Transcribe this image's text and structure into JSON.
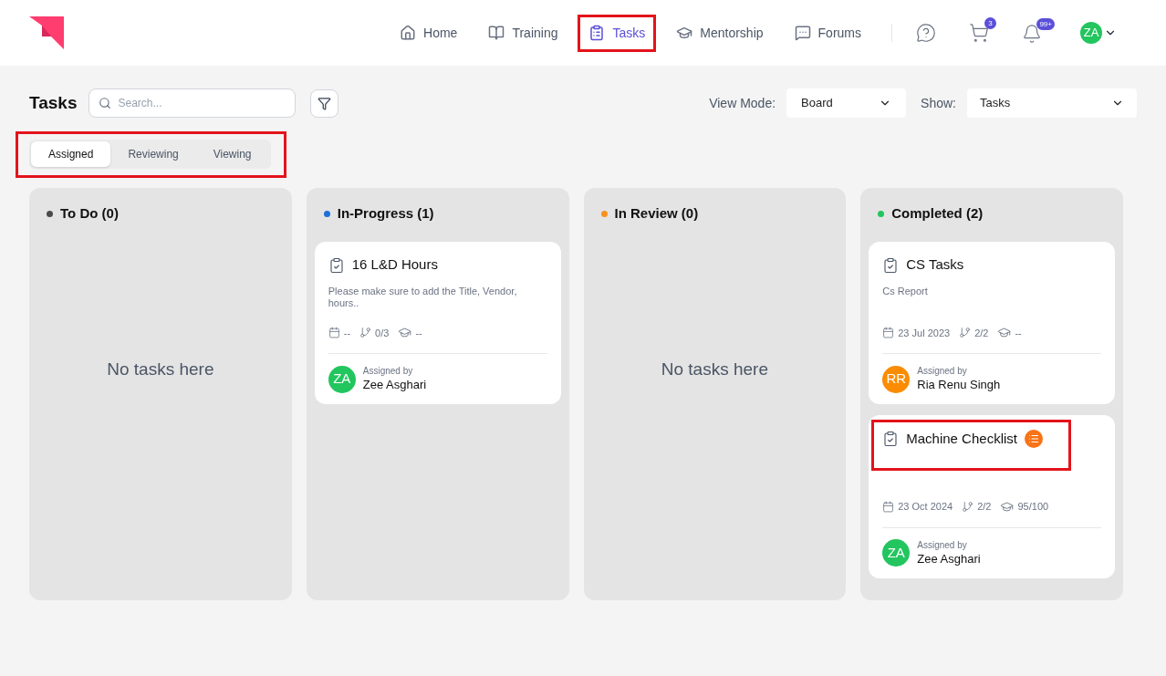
{
  "nav": {
    "items": [
      {
        "label": "Home",
        "selected": false,
        "highlighted": false
      },
      {
        "label": "Training",
        "selected": false,
        "highlighted": false
      },
      {
        "label": "Tasks",
        "selected": true,
        "highlighted": true
      },
      {
        "label": "Mentorship",
        "selected": false,
        "highlighted": false
      },
      {
        "label": "Forums",
        "selected": false,
        "highlighted": false
      }
    ],
    "cart_badge": "3",
    "bell_badge": "99+",
    "avatar": {
      "initials": "ZA",
      "color": "#22c55e"
    }
  },
  "toolbar": {
    "title": "Tasks",
    "search": {
      "placeholder": "Search..."
    },
    "view_mode": {
      "label": "View Mode:",
      "value": "Board"
    },
    "show": {
      "label": "Show:",
      "value": "Tasks"
    }
  },
  "tabs": {
    "highlighted": true,
    "items": [
      {
        "label": "Assigned",
        "selected": true
      },
      {
        "label": "Reviewing",
        "selected": false
      },
      {
        "label": "Viewing",
        "selected": false
      }
    ]
  },
  "columns": [
    {
      "title": "To Do (0)",
      "color": "#4b4b4b",
      "empty_text": "No tasks here"
    },
    {
      "title": "In-Progress (1)",
      "color": "#1e6fd9",
      "cards": [
        {
          "title": "16 L&D Hours",
          "checklist": false,
          "highlighted": false,
          "description": "Please make sure to add the Title, Vendor, hours..",
          "date": "--",
          "subtasks": "0/3",
          "score": "--",
          "assigned_label": "Assigned by",
          "assignee": "Zee Asghari",
          "initials": "ZA",
          "color": "#22c55e"
        }
      ]
    },
    {
      "title": "In Review (0)",
      "color": "#f7931e",
      "empty_text": "No tasks here"
    },
    {
      "title": "Completed (2)",
      "color": "#22c55e",
      "cards": [
        {
          "title": "CS Tasks",
          "checklist": false,
          "highlighted": false,
          "description": "Cs Report",
          "date": "23 Jul 2023",
          "subtasks": "2/2",
          "score": "--",
          "assigned_label": "Assigned by",
          "assignee": "Ria Renu Singh",
          "initials": "RR",
          "color": "#fb8c00"
        },
        {
          "title": "Machine Checklist",
          "checklist": true,
          "highlighted": true,
          "date": "23 Oct 2024",
          "subtasks": "2/2",
          "score": "95/100",
          "assigned_label": "Assigned by",
          "assignee": "Zee Asghari",
          "initials": "ZA",
          "color": "#22c55e"
        }
      ]
    }
  ]
}
